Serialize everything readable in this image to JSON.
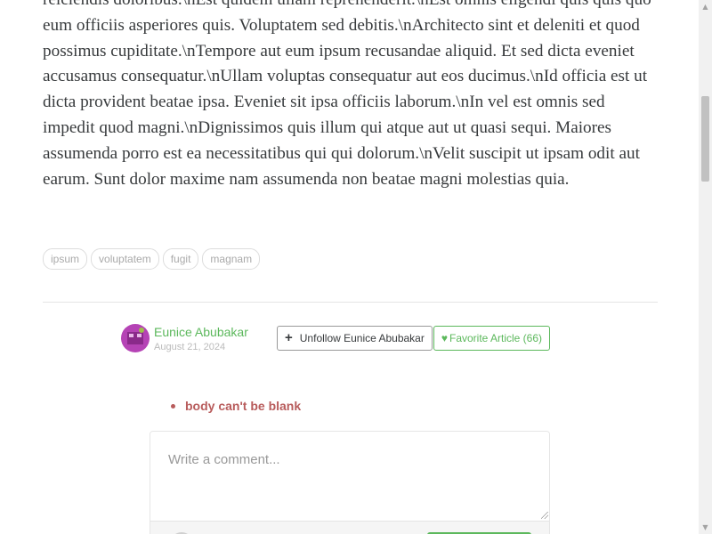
{
  "article": {
    "body": "reiciendis doloribus.\\nEst quidem ullam reprehenderit.\\nEst omnis eligendi quis quis quo eum officiis asperiores quis. Voluptatem sed debitis.\\nArchitecto sint et deleniti et quod possimus cupiditate.\\nTempore aut eum ipsum recusandae aliquid. Et sed dicta eveniet accusamus consequatur.\\nUllam voluptas consequatur aut eos ducimus.\\nId officia est ut dicta provident beatae ipsa. Eveniet sit ipsa officiis laborum.\\nIn vel est omnis sed impedit quod magni.\\nDignissimos quis illum qui atque aut ut quasi sequi. Maiores assumenda porro est ea necessitatibus qui qui dolorum.\\nVelit suscipit ut ipsam odit aut earum. Sunt dolor maxime nam assumenda non beatae magni molestias quia.",
    "tags": [
      "ipsum",
      "voluptatem",
      "fugit",
      "magnam"
    ]
  },
  "meta": {
    "author": "Eunice Abubakar",
    "date": "August 21, 2024",
    "follow_icon": "+",
    "follow_label": "Unfollow Eunice Abubakar",
    "favorite_icon": "♥",
    "favorite_label": "Favorite Article (66)"
  },
  "comments": {
    "errors": [
      "body can't be blank"
    ],
    "placeholder": "Write a comment..."
  },
  "colors": {
    "accent": "#5cb85c",
    "error": "#b85c5c",
    "text": "#373a3c"
  },
  "icons": {
    "follow": "plus-icon",
    "favorite": "heart-icon",
    "scroll_up": "arrow-up-icon",
    "scroll_down": "arrow-down-icon"
  },
  "scrollbar": {
    "up_glyph": "▲",
    "down_glyph": "▼"
  }
}
